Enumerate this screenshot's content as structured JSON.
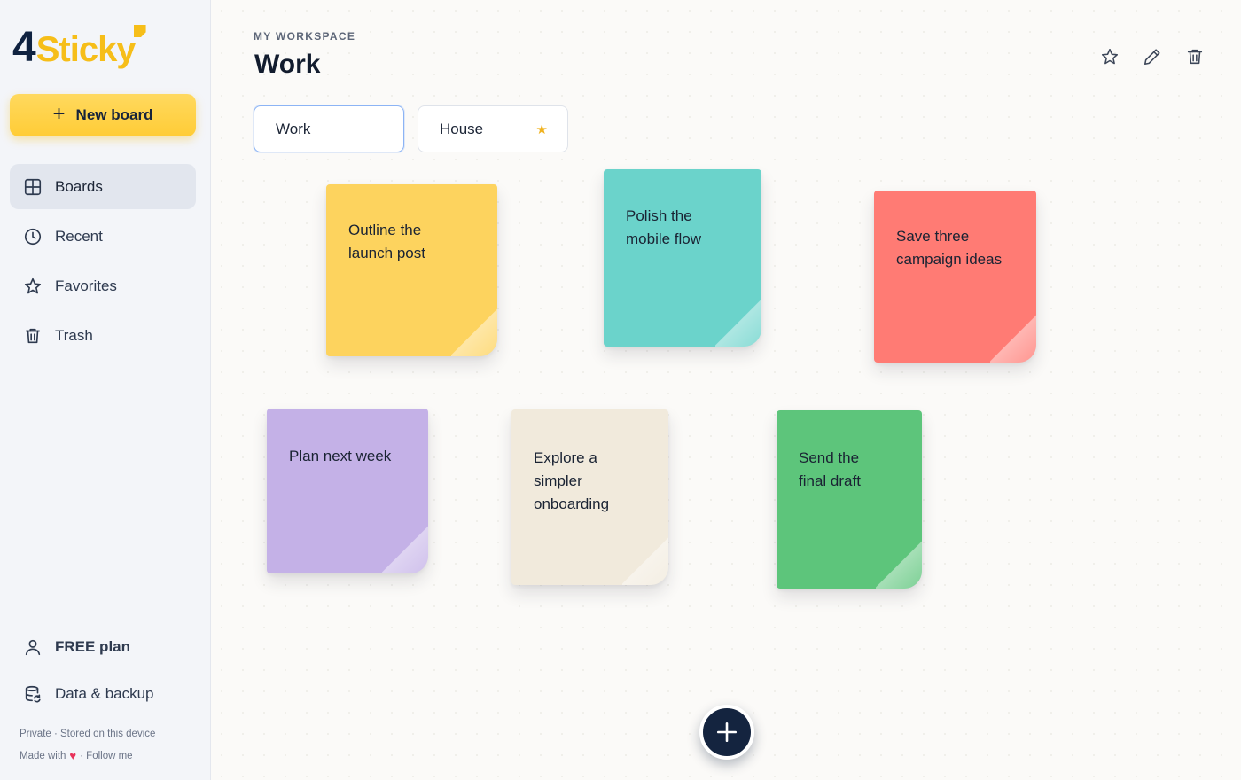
{
  "brand": {
    "logo_number": "4",
    "logo_word": "Sticky",
    "accent_color": "#f6be19",
    "navy_color": "#0f2240"
  },
  "sidebar": {
    "new_board_label": "New board",
    "items": [
      {
        "label": "Boards",
        "icon": "grid-icon",
        "active": true
      },
      {
        "label": "Recent",
        "icon": "clock-icon",
        "active": false
      },
      {
        "label": "Favorites",
        "icon": "star-icon",
        "active": false
      },
      {
        "label": "Trash",
        "icon": "trash-icon",
        "active": false
      }
    ],
    "plan_label": "FREE plan",
    "backup_label": "Data & backup",
    "footnote_1": "Private · Stored on this device",
    "footnote_made_with": "Made with",
    "footnote_follow": "· Follow me"
  },
  "header": {
    "eyebrow": "MY WORKSPACE",
    "title": "Work",
    "actions": [
      "star-icon",
      "pencil-icon",
      "trash-icon"
    ]
  },
  "tabs": [
    {
      "label": "Work",
      "active": true,
      "favorite": false
    },
    {
      "label": "House",
      "active": false,
      "favorite": true
    }
  ],
  "notes": [
    {
      "text_line1": "Outline the",
      "text_line2": "launch post",
      "color": "#fdd35e"
    },
    {
      "text_line1": "Polish the",
      "text_line2": "mobile flow",
      "color": "#6bd3cb"
    },
    {
      "text_line1": "Save three",
      "text_line2": "campaign ideas",
      "color": "#ff7b74"
    },
    {
      "text_line1": "Plan next week",
      "color": "#c4b1e7"
    },
    {
      "text_line1": "Explore a",
      "text_line2": "simpler",
      "text_line3": "onboarding",
      "color": "#f1eadc"
    },
    {
      "text_line1": "Send the",
      "text_line2": "final draft",
      "color": "#5dc57b"
    }
  ],
  "fab": {
    "icon": "plus-icon"
  }
}
